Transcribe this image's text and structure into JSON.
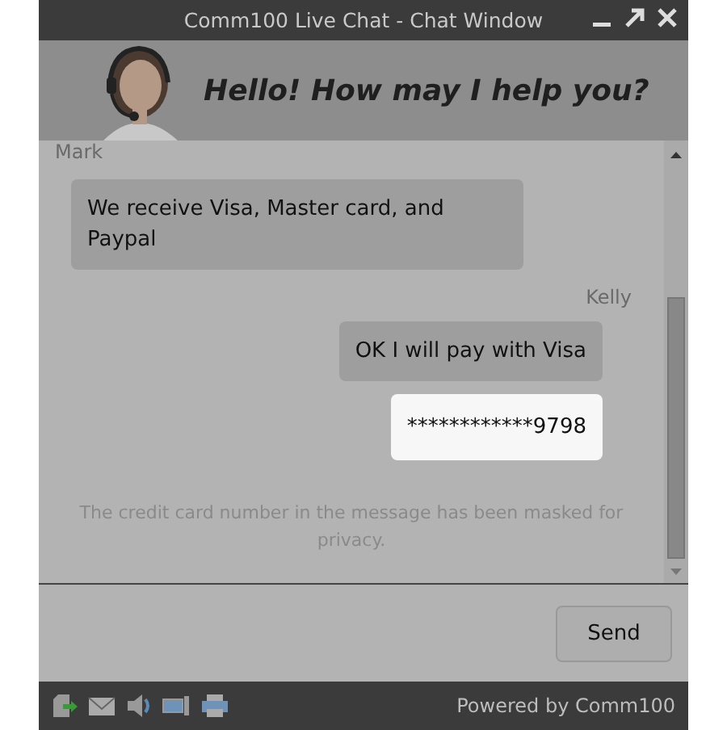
{
  "window": {
    "title": "Comm100 Live Chat - Chat Window"
  },
  "banner": {
    "kind": "picture",
    "greeting": "Hello! How may I help you?"
  },
  "messages": [
    {
      "sender": "Mark",
      "kind": "incoming",
      "text": "We receive Visa, Master card, and Paypal"
    },
    {
      "sender": "Kelly",
      "kind": "outgoing",
      "text": "OK I will pay with Visa"
    },
    {
      "kind": "masked",
      "text": "************9798"
    },
    {
      "kind": "notice",
      "text": "The credit card number in the message has been masked for privacy."
    }
  ],
  "send_button": "Send",
  "footer": {
    "powered_by": "Powered by Comm100"
  }
}
